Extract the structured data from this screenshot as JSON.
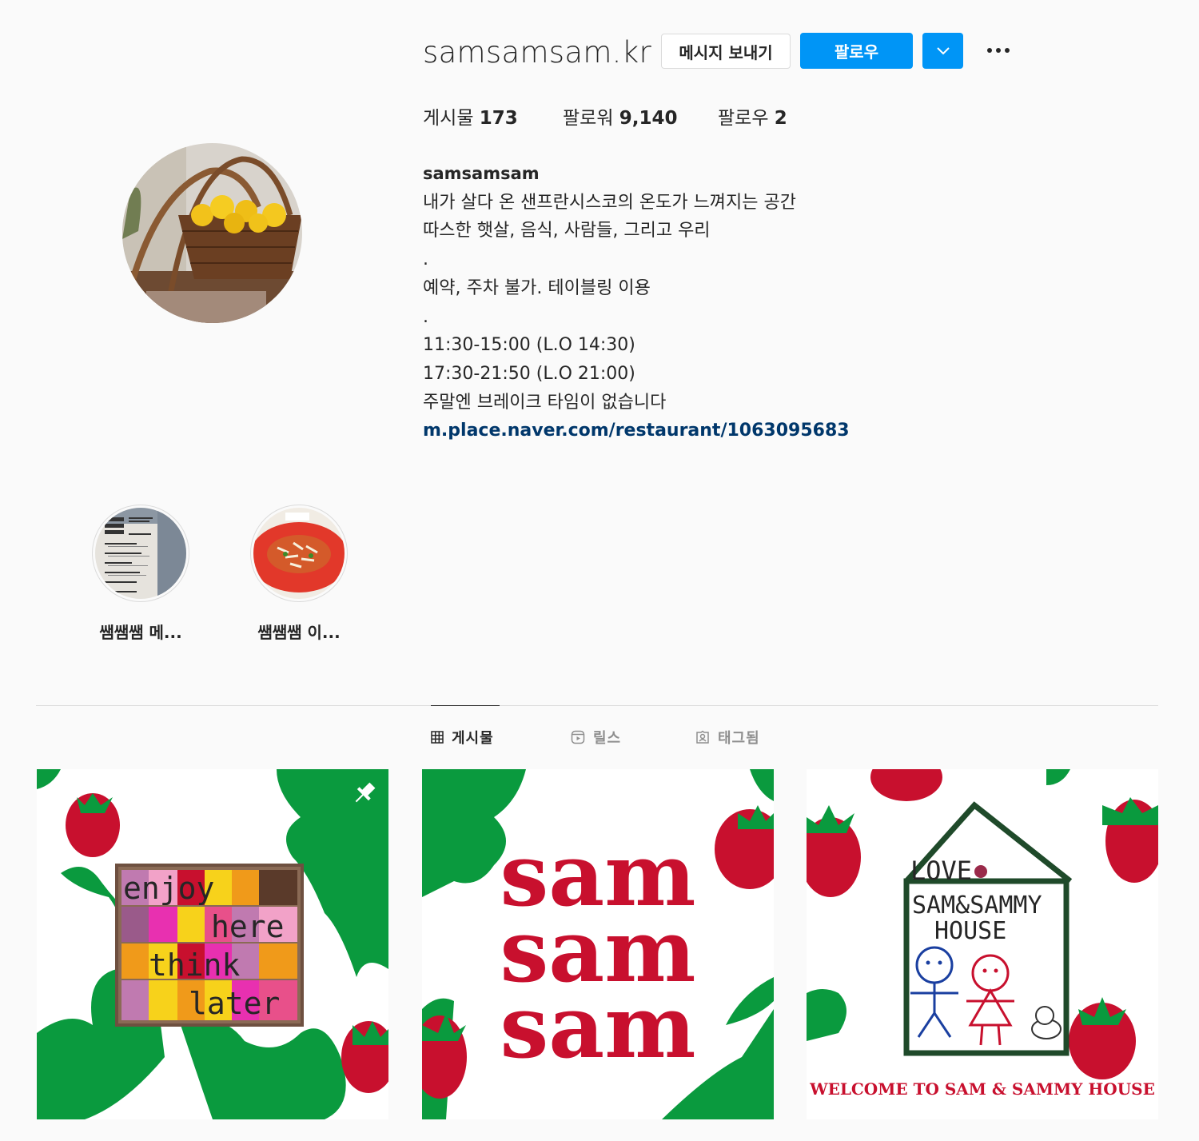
{
  "profile": {
    "username": "samsamsam.kr",
    "message_label": "메시지 보내기",
    "follow_label": "팔로우"
  },
  "stats": {
    "posts_label": "게시물",
    "posts_value": "173",
    "followers_label": "팔로워",
    "followers_value": "9,140",
    "following_label": "팔로우",
    "following_value": "2"
  },
  "bio": {
    "name": "samsamsam",
    "lines": [
      "내가 살다 온 샌프란시스코의 온도가 느껴지는 공간",
      "따스한 햇살, 음식, 사람들, 그리고 우리",
      ".",
      "예약, 주차 불가. 테이블링 이용",
      ".",
      "11:30-15:00 (L.O 14:30)",
      "17:30-21:50 (L.O 21:00)",
      "주말엔 브레이크 타임이 없습니다"
    ],
    "link": "m.place.naver.com/restaurant/1063095683"
  },
  "highlights": [
    {
      "label": "쌤쌤쌤 메..."
    },
    {
      "label": "쌤쌤쌤 이..."
    }
  ],
  "tabs": [
    {
      "label": "게시물",
      "icon": "grid-icon"
    },
    {
      "label": "릴스",
      "icon": "reels-icon"
    },
    {
      "label": "태그됨",
      "icon": "tagged-icon"
    }
  ],
  "posts": [
    {
      "words": [
        "enjoy",
        "here",
        "think",
        "later"
      ],
      "icon": "pin-icon"
    },
    {
      "words": [
        "sam",
        "sam",
        "sam"
      ]
    },
    {
      "love": "LOVE",
      "title_lines": [
        "SAM&SAMMY",
        "HOUSE"
      ],
      "caption": "WELCOME TO SAM & SAMMY HOUSE"
    }
  ],
  "colors": {
    "accent": "#0095f6",
    "tomato_red": "#c8102e",
    "leaf_green": "#0a9a3e",
    "link": "#00376b"
  }
}
